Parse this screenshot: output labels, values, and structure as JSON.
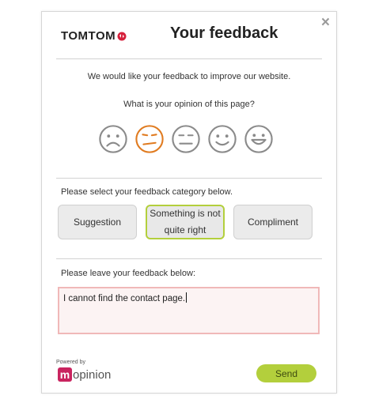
{
  "dialog": {
    "close_label": "×",
    "brand": "TOMTOM",
    "title": "Your feedback",
    "intro": "We would like your feedback to improve our website.",
    "question": "What is your opinion of this page?",
    "rating": {
      "options": [
        "very-unhappy",
        "unhappy",
        "neutral",
        "happy",
        "very-happy"
      ],
      "selected": "unhappy"
    },
    "category_prompt": "Please select your feedback category below.",
    "categories": [
      {
        "label": "Suggestion",
        "selected": false
      },
      {
        "label": "Something is not quite right",
        "selected": true
      },
      {
        "label": "Compliment",
        "selected": false
      }
    ],
    "feedback_prompt": "Please leave your feedback below:",
    "feedback_value": "I cannot find the contact page.",
    "powered_by": "Powered by",
    "powered_brand_letter": "m",
    "powered_brand_rest": "opinion",
    "send_label": "Send"
  },
  "colors": {
    "accent_green": "#b3cf3c",
    "selected_smiley": "#e07b20",
    "brand_red": "#d6213c",
    "mopinion_pink": "#c9245f",
    "textarea_border": "#f0b8b8"
  }
}
